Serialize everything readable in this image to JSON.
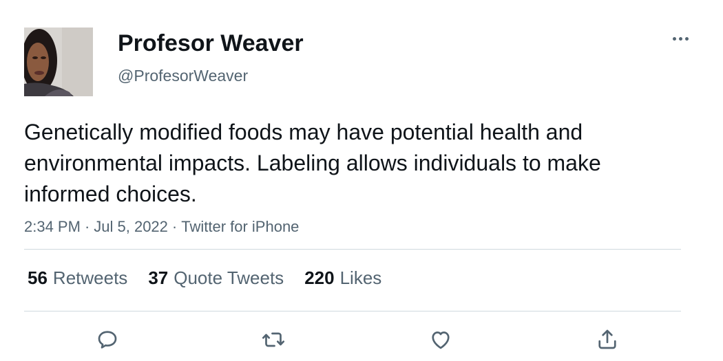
{
  "tweet": {
    "author": {
      "display_name": "Profesor Weaver",
      "handle": "@ProfesorWeaver"
    },
    "text": "Genetically modified foods may have potential health and environmental impacts. Labeling allows individuals to make informed choices.",
    "time": "2:34 PM",
    "date": "Jul 5, 2022",
    "source": "Twitter for iPhone",
    "separator": "·"
  },
  "stats": {
    "retweets": {
      "count": "56",
      "label": "Retweets"
    },
    "quote_tweets": {
      "count": "37",
      "label": "Quote Tweets"
    },
    "likes": {
      "count": "220",
      "label": "Likes"
    }
  },
  "icons": {
    "more": "more-horizontal-icon",
    "reply": "reply-bubble-icon",
    "retweet": "retweet-arrows-icon",
    "like": "heart-icon",
    "share": "share-upload-icon"
  },
  "colors": {
    "text_primary": "#0f1419",
    "text_secondary": "#536471",
    "divider": "#cfd9de"
  }
}
